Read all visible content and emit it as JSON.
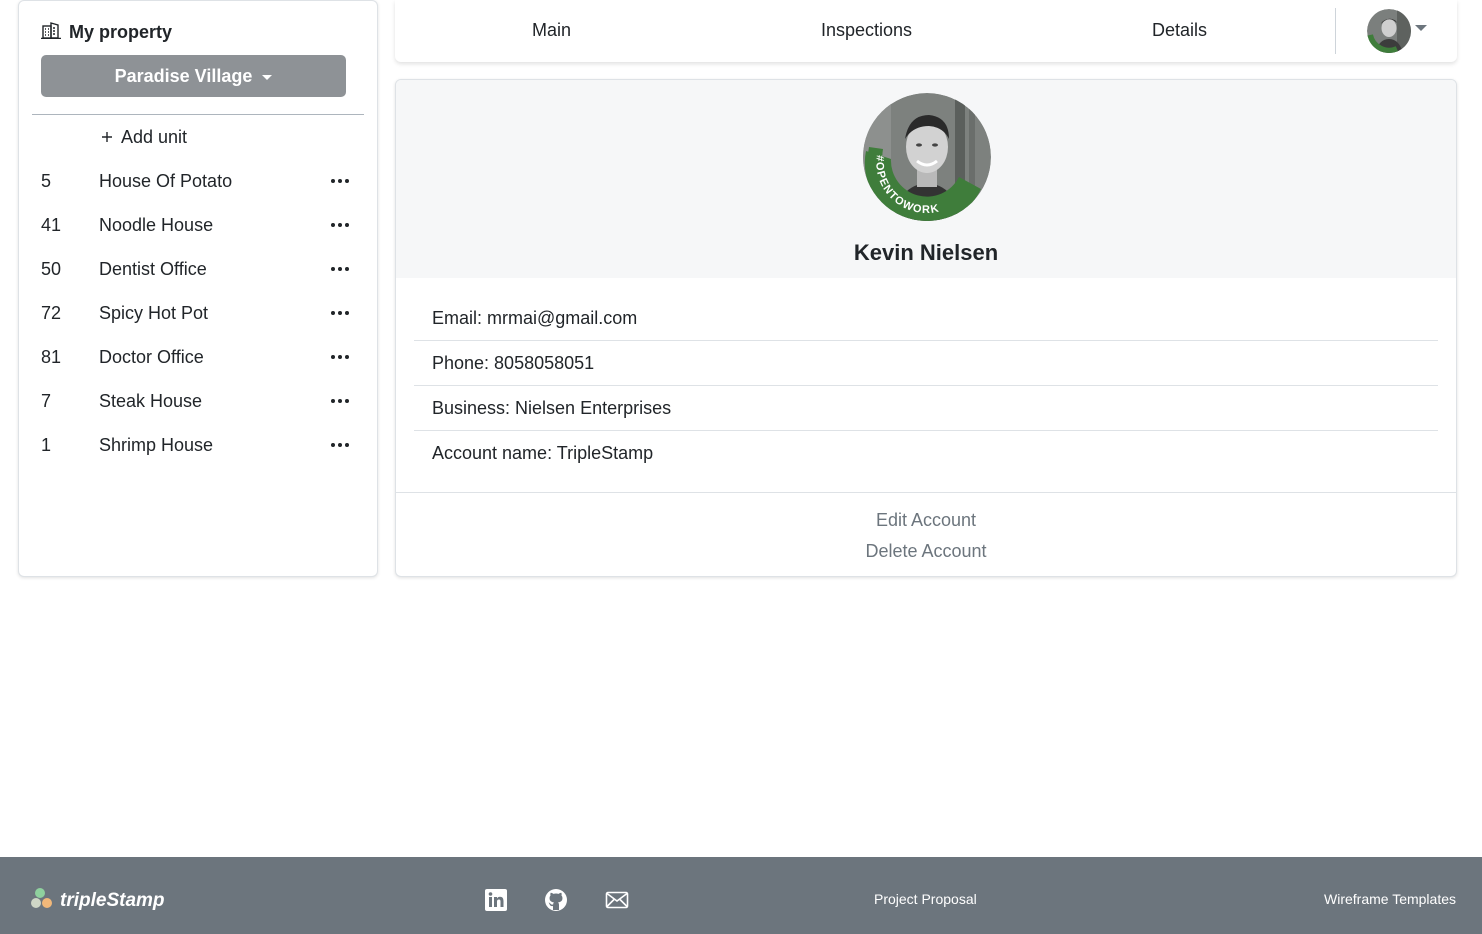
{
  "sidebar": {
    "title": "My property",
    "property_selector": "Paradise Village",
    "add_unit_label": "Add unit",
    "units": [
      {
        "number": "5",
        "name": "House Of Potato"
      },
      {
        "number": "41",
        "name": "Noodle House"
      },
      {
        "number": "50",
        "name": "Dentist Office"
      },
      {
        "number": "72",
        "name": "Spicy Hot Pot"
      },
      {
        "number": "81",
        "name": "Doctor Office"
      },
      {
        "number": "7",
        "name": "Steak House"
      },
      {
        "number": "1",
        "name": "Shrimp House"
      }
    ]
  },
  "nav": {
    "tabs": [
      "Main",
      "Inspections",
      "Details"
    ]
  },
  "profile": {
    "name": "Kevin Nielsen",
    "badge_text": "#OPENTOWORK",
    "email": "Email: mrmai@gmail.com",
    "phone": "Phone: 8058058051",
    "business": "Business: Nielsen Enterprises",
    "account_name": "Account name: TripleStamp",
    "edit_label": "Edit Account",
    "delete_label": "Delete Account"
  },
  "footer": {
    "brand": "tripleStamp",
    "project_proposal": "Project Proposal",
    "wireframe_templates": "Wireframe Templates"
  },
  "colors": {
    "footer_bg": "#6c757d",
    "property_button": "#8e9296",
    "badge_green": "#3f7d3b",
    "card_head_bg": "#f6f7f8"
  }
}
